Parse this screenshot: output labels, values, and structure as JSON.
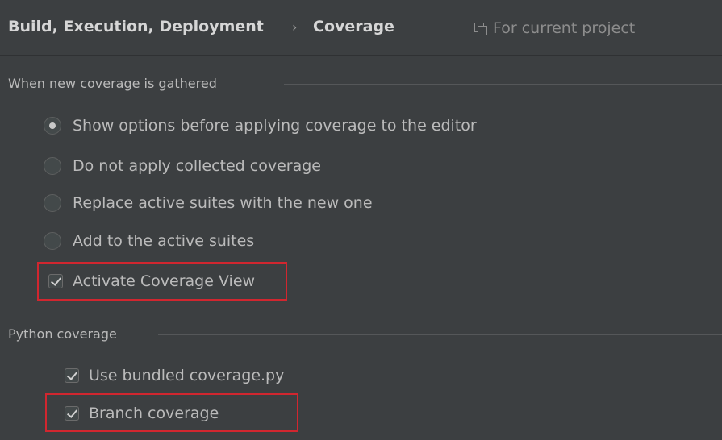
{
  "header": {
    "crumb_1": "Build, Execution, Deployment",
    "separator": "›",
    "crumb_2": "Coverage",
    "project_tag": "For current project",
    "project_icon": "copy-icon"
  },
  "gathered_section": {
    "title": "When new coverage is gathered",
    "options": [
      {
        "label": "Show options before applying coverage to the editor",
        "selected": true
      },
      {
        "label": "Do not apply collected coverage",
        "selected": false
      },
      {
        "label": "Replace active suites with the new one",
        "selected": false
      },
      {
        "label": "Add to the active suites",
        "selected": false
      }
    ],
    "activate_view": {
      "label": "Activate Coverage View",
      "checked": true
    }
  },
  "python_section": {
    "title": "Python coverage",
    "bundled": {
      "label": "Use bundled coverage.py",
      "checked": true
    },
    "branch": {
      "label": "Branch coverage",
      "checked": true
    }
  },
  "colors": {
    "background": "#3c3f41",
    "text": "#bbbbbb",
    "highlight": "#d1262f"
  }
}
